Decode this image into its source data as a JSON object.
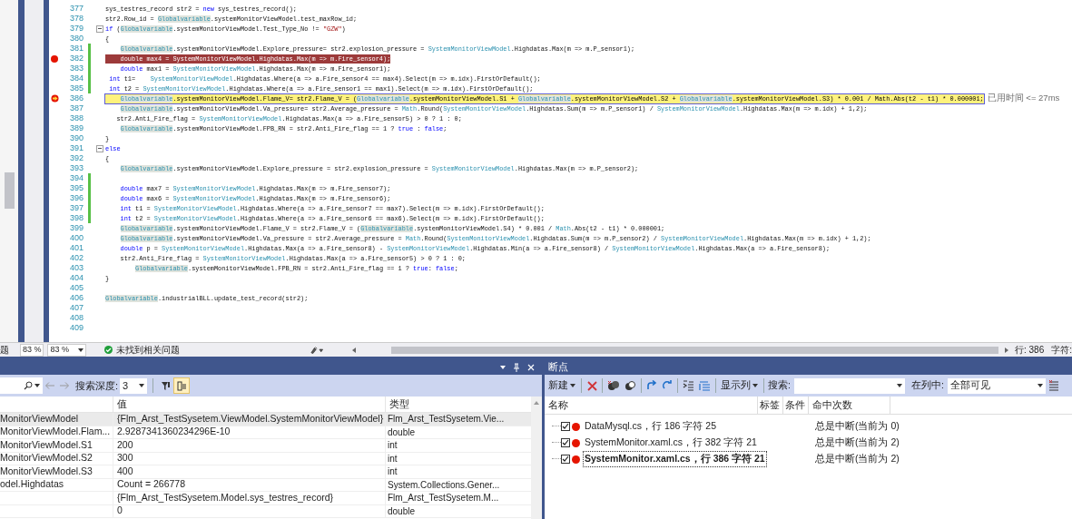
{
  "editor": {
    "lines": [
      {
        "number": "377",
        "segments": [
          {
            "t": "sys_testres_record str2 = "
          },
          {
            "t": "new",
            "kind": "keyword"
          },
          {
            "t": " sys_testres_record();"
          }
        ]
      },
      {
        "number": "378",
        "segments": [
          {
            "t": "str2.Row_id = "
          },
          {
            "t": "Globalvariable",
            "kind": "global"
          },
          {
            "t": ".systemMonitorViewModel.test_maxRow_id;"
          }
        ]
      },
      {
        "number": "379",
        "fold": true,
        "segments": [
          {
            "t": "if",
            "kind": "keyword"
          },
          {
            "t": " ("
          },
          {
            "t": "Globalvariable",
            "kind": "global"
          },
          {
            "t": ".systemMonitorViewModel.Test_Type_No != "
          },
          {
            "t": "\"GZW\"",
            "kind": "string"
          },
          {
            "t": ")"
          }
        ]
      },
      {
        "number": "380",
        "segments": [
          {
            "t": "{"
          }
        ]
      },
      {
        "number": "381",
        "changed": true,
        "segments": [
          {
            "t": "    Globalvariable",
            "kind": "global"
          },
          {
            "t": ".systemMonitorViewModel.Explore_pressure= str2.explosion_pressure = "
          },
          {
            "t": "SystemMonitorViewModel",
            "kind": "type"
          },
          {
            "t": ".Highdatas.Max(m => m.P_sensor1);"
          }
        ]
      },
      {
        "number": "382",
        "changed": true,
        "breakpoint": true,
        "segments": [
          {
            "t": "    double max4 = SystemMonitorViewModel.Highdatas.Max(m => m.Fire_sensor4);"
          }
        ]
      },
      {
        "number": "383",
        "changed": true,
        "segments": [
          {
            "t": "    double",
            "kind": "keyword"
          },
          {
            "t": " max1 = "
          },
          {
            "t": "SystemMonitorViewModel",
            "kind": "type"
          },
          {
            "t": ".Highdatas.Max(m => m.Fire_sensor1);"
          }
        ]
      },
      {
        "number": "384",
        "changed": true,
        "segments": [
          {
            "t": " int",
            "kind": "keyword"
          },
          {
            "t": " t1=    "
          },
          {
            "t": "SystemMonitorViewModel",
            "kind": "type"
          },
          {
            "t": ".Highdatas.Where(a => a.Fire_sensor4 == max4).Select(m => m.idx).FirstOrDefault();"
          }
        ]
      },
      {
        "number": "385",
        "changed": true,
        "segments": [
          {
            "t": " int",
            "kind": "keyword"
          },
          {
            "t": " t2 = "
          },
          {
            "t": "SystemMonitorViewModel",
            "kind": "type"
          },
          {
            "t": ".Highdatas.Where(a => a.Fire_sensor1 == max1).Select(m => m.idx).FirstOrDefault();"
          }
        ]
      },
      {
        "number": "386",
        "current": true,
        "hint": "已用时间 <= 27ms",
        "segments": [
          {
            "t": "    Globalvariable",
            "kind": "global"
          },
          {
            "t": ".systemMonitorViewModel.Flame_V= str2.Flame_V = ("
          },
          {
            "t": "Globalvariable",
            "kind": "global"
          },
          {
            "t": ".systemMonitorViewModel.S1 + "
          },
          {
            "t": "Globalvariable",
            "kind": "global"
          },
          {
            "t": ".systemMonitorViewModel.S2 + "
          },
          {
            "t": "Globalvariable",
            "kind": "global"
          },
          {
            "t": ".systemMonitorViewModel.S3) * 0.001 / Math.Abs(t2 - t1) * 0.000001;"
          }
        ]
      },
      {
        "number": "387",
        "segments": [
          {
            "t": "    Globalvariable",
            "kind": "global"
          },
          {
            "t": ".systemMonitorViewModel.Va_pressure= str2.Average_pressure = "
          },
          {
            "t": "Math",
            "kind": "type"
          },
          {
            "t": ".Round("
          },
          {
            "t": "SystemMonitorViewModel",
            "kind": "type"
          },
          {
            "t": ".Highdatas.Sum(m => m.P_sensor1) / "
          },
          {
            "t": "SystemMonitorViewModel",
            "kind": "type"
          },
          {
            "t": ".Highdatas.Max(m => m.idx) + 1,2);"
          }
        ]
      },
      {
        "number": "388",
        "segments": [
          {
            "t": "   str2.Anti_Fire_flag = "
          },
          {
            "t": "SystemMonitorViewModel",
            "kind": "type"
          },
          {
            "t": ".Highdatas.Max(a => a.Fire_sensor5) > 0 ? 1 : 0;"
          }
        ]
      },
      {
        "number": "389",
        "segments": [
          {
            "t": "    Globalvariable",
            "kind": "global"
          },
          {
            "t": ".systemMonitorViewModel.FPB_RN = str2.Anti_Fire_flag == 1 ? "
          },
          {
            "t": "true",
            "kind": "keyword"
          },
          {
            "t": " : "
          },
          {
            "t": "false",
            "kind": "keyword"
          },
          {
            "t": ";"
          }
        ]
      },
      {
        "number": "390",
        "segments": [
          {
            "t": "}"
          }
        ]
      },
      {
        "number": "391",
        "fold": true,
        "segments": [
          {
            "t": "else",
            "kind": "keyword"
          }
        ]
      },
      {
        "number": "392",
        "segments": [
          {
            "t": "{"
          }
        ]
      },
      {
        "number": "393",
        "segments": [
          {
            "t": "    Globalvariable",
            "kind": "global"
          },
          {
            "t": ".systemMonitorViewModel.Explore_pressure = str2.explosion_pressure = "
          },
          {
            "t": "SystemMonitorViewModel",
            "kind": "type"
          },
          {
            "t": ".Highdatas.Max(m => m.P_sensor2);"
          }
        ]
      },
      {
        "number": "394",
        "changed": true
      },
      {
        "number": "395",
        "changed": true,
        "segments": [
          {
            "t": "    double",
            "kind": "keyword"
          },
          {
            "t": " max7 = "
          },
          {
            "t": "SystemMonitorViewModel",
            "kind": "type"
          },
          {
            "t": ".Highdatas.Max(m => m.Fire_sensor7);"
          }
        ]
      },
      {
        "number": "396",
        "changed": true,
        "segments": [
          {
            "t": "    double",
            "kind": "keyword"
          },
          {
            "t": " max6 = "
          },
          {
            "t": "SystemMonitorViewModel",
            "kind": "type"
          },
          {
            "t": ".Highdatas.Max(m => m.Fire_sensor6);"
          }
        ]
      },
      {
        "number": "397",
        "changed": true,
        "segments": [
          {
            "t": "    int",
            "kind": "keyword"
          },
          {
            "t": " t1 = "
          },
          {
            "t": "SystemMonitorViewModel",
            "kind": "type"
          },
          {
            "t": ".Highdatas.Where(a => a.Fire_sensor7 == max7).Select(m => m.idx).FirstOrDefault();"
          }
        ]
      },
      {
        "number": "398",
        "changed": true,
        "segments": [
          {
            "t": "    int",
            "kind": "keyword"
          },
          {
            "t": " t2 = "
          },
          {
            "t": "SystemMonitorViewModel",
            "kind": "type"
          },
          {
            "t": ".Highdatas.Where(a => a.Fire_sensor6 == max6).Select(m => m.idx).FirstOrDefault();"
          }
        ]
      },
      {
        "number": "399",
        "segments": [
          {
            "t": "    Globalvariable",
            "kind": "global"
          },
          {
            "t": ".systemMonitorViewModel.Flame_V = str2.Flame_V = ("
          },
          {
            "t": "Globalvariable",
            "kind": "global"
          },
          {
            "t": ".systemMonitorViewModel.S4) * 0.001 / "
          },
          {
            "t": "Math",
            "kind": "type"
          },
          {
            "t": ".Abs(t2 - t1) * 0.000001;"
          }
        ]
      },
      {
        "number": "400",
        "segments": [
          {
            "t": "    Globalvariable",
            "kind": "global"
          },
          {
            "t": ".systemMonitorViewModel.Va_pressure = str2.Average_pressure = "
          },
          {
            "t": "Math",
            "kind": "type"
          },
          {
            "t": ".Round("
          },
          {
            "t": "SystemMonitorViewModel",
            "kind": "type"
          },
          {
            "t": ".Highdatas.Sum(m => m.P_sensor2) / "
          },
          {
            "t": "SystemMonitorViewModel",
            "kind": "type"
          },
          {
            "t": ".Highdatas.Max(m => m.idx) + 1,2);"
          }
        ]
      },
      {
        "number": "401",
        "segments": [
          {
            "t": "    double",
            "kind": "keyword"
          },
          {
            "t": " p = "
          },
          {
            "t": "SystemMonitorViewModel",
            "kind": "type"
          },
          {
            "t": ".Highdatas.Max(a => a.Fire_sensor8) - "
          },
          {
            "t": "SystemMonitorViewModel",
            "kind": "type"
          },
          {
            "t": ".Highdatas.Min(a => a.Fire_sensor8) / "
          },
          {
            "t": "SystemMonitorViewModel",
            "kind": "type"
          },
          {
            "t": ".Highdatas.Max(a => a.Fire_sensor8);"
          }
        ]
      },
      {
        "number": "402",
        "segments": [
          {
            "t": "    str2.Anti_Fire_flag = "
          },
          {
            "t": "SystemMonitorViewModel",
            "kind": "type"
          },
          {
            "t": ".Highdatas.Max(a => a.Fire_sensor5) > 0 ? 1 : 0;"
          }
        ]
      },
      {
        "number": "403",
        "segments": [
          {
            "t": "        Globalvariable",
            "kind": "global"
          },
          {
            "t": ".systemMonitorViewModel.FPB_RN = str2.Anti_Fire_flag == 1 ? "
          },
          {
            "t": "true",
            "kind": "keyword"
          },
          {
            "t": ": "
          },
          {
            "t": "false",
            "kind": "keyword"
          },
          {
            "t": ";"
          }
        ]
      },
      {
        "number": "404",
        "segments": [
          {
            "t": "}"
          }
        ]
      },
      {
        "number": "405"
      },
      {
        "number": "406",
        "segments": [
          {
            "t": "Globalvariable",
            "kind": "global"
          },
          {
            "t": ".industrialBLL.update_test_record(str2);"
          }
        ]
      },
      {
        "number": "407"
      },
      {
        "number": "408"
      },
      {
        "number": "409"
      }
    ]
  },
  "status_bar": {
    "left_label": "题",
    "zoom_box": "83 %",
    "zoom_select": "83 %",
    "issues": "未找到相关问题",
    "line": "行: 386",
    "column": "字符:"
  },
  "watch_panel": {
    "search_depth_label": "搜索深度:",
    "search_depth": "3",
    "columns": [
      "值",
      "类型"
    ],
    "rows": [
      {
        "name": "MonitorViewModel",
        "value": "{Flm_Arst_TestSysetem.ViewModel.SystemMonitorViewModel}",
        "type": "Flm_Arst_TestSysetem.Vie...",
        "selected": true
      },
      {
        "name": "MonitorViewModel.Flam...",
        "value": "2.9287341360234296E-10",
        "type": "double",
        "selected": false
      },
      {
        "name": "MonitorViewModel.S1",
        "value": "200",
        "type": "int",
        "selected": false
      },
      {
        "name": "MonitorViewModel.S2",
        "value": "300",
        "type": "int",
        "selected": false
      },
      {
        "name": "MonitorViewModel.S3",
        "value": "400",
        "type": "int",
        "selected": false
      },
      {
        "name": "odel.Highdatas",
        "value": "Count = 266778",
        "type": "System.Collections.Gener...",
        "selected": false
      },
      {
        "value": "{Flm_Arst_TestSysetem.Model.sys_testres_record}",
        "type": "Flm_Arst_TestSysetem.M...",
        "selected": false
      },
      {
        "value": "0",
        "type": "double",
        "selected": false
      }
    ]
  },
  "breakpoints_panel": {
    "title": "断点",
    "new_label": "新建",
    "columns_label": "显示列",
    "search_label": "搜索:",
    "in_column_label": "在列中:",
    "in_column_value": "全部可见",
    "columns": [
      "名称",
      "标签",
      "条件",
      "命中次数"
    ],
    "rows": [
      {
        "name": "DataMysql.cs，行 186 字符 25",
        "hits": "总是中断(当前为 0)",
        "checked": true,
        "selected": false
      },
      {
        "name": "SystemMonitor.xaml.cs，行 382 字符 21",
        "hits": "总是中断(当前为 2)",
        "checked": true,
        "selected": false
      },
      {
        "name": "SystemMonitor.xaml.cs，行 386 字符 21",
        "hits": "总是中断(当前为 2)",
        "checked": true,
        "selected": true
      }
    ]
  }
}
